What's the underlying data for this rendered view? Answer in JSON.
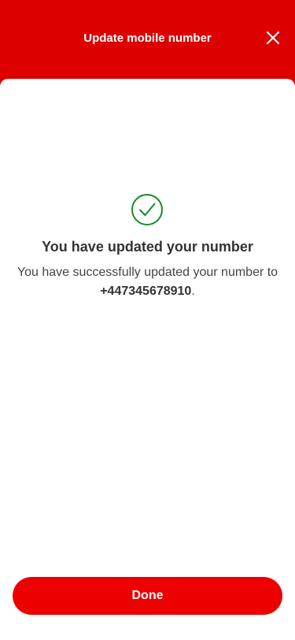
{
  "header": {
    "title": "Update mobile number",
    "close_icon": "close-icon"
  },
  "result": {
    "status_icon": "check-circle-icon",
    "status_color": "#188a2e",
    "title": "You have updated your number",
    "message_prefix": "You have successfully updated your number to ",
    "phone_number": "+447345678910",
    "message_suffix": "."
  },
  "footer": {
    "done_label": "Done"
  },
  "colors": {
    "brand": "#ec0000",
    "header_bg": "#dc0000",
    "success": "#188a2e",
    "text_primary": "#333333",
    "text_secondary": "#444444"
  }
}
